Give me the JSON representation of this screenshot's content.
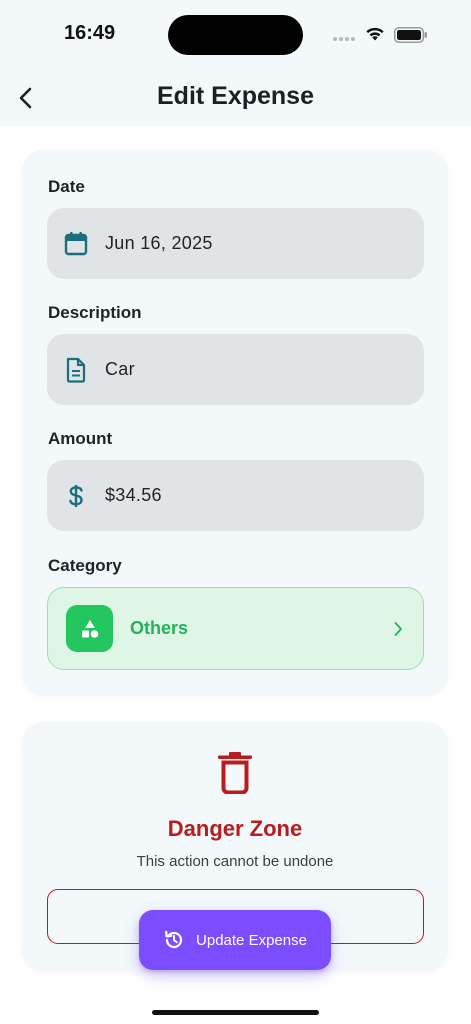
{
  "status_bar": {
    "time": "16:49",
    "wifi_icon": "wifi-icon",
    "battery_icon": "battery-icon",
    "signal_icon": "cellular-dots-icon"
  },
  "nav": {
    "title": "Edit Expense",
    "back_icon": "chevron-left-icon"
  },
  "form": {
    "date": {
      "label": "Date",
      "value": "Jun 16, 2025",
      "icon": "calendar-icon"
    },
    "description": {
      "label": "Description",
      "value": "Car",
      "icon": "document-icon"
    },
    "amount": {
      "label": "Amount",
      "value": "$34.56",
      "icon": "dollar-icon"
    },
    "category": {
      "label": "Category",
      "value": "Others",
      "icon": "shapes-icon",
      "color": "#22c55e"
    }
  },
  "danger_zone": {
    "icon": "trash-icon",
    "title": "Danger Zone",
    "subtitle": "This action cannot be undone",
    "color": "#b91c1c"
  },
  "update_button": {
    "label": "Update Expense",
    "icon": "refresh-icon",
    "color": "#7c4dff"
  },
  "colors": {
    "accent_teal": "#1c6e78",
    "card_background": "#f3f8fb",
    "field_background": "#e0e4e7"
  }
}
